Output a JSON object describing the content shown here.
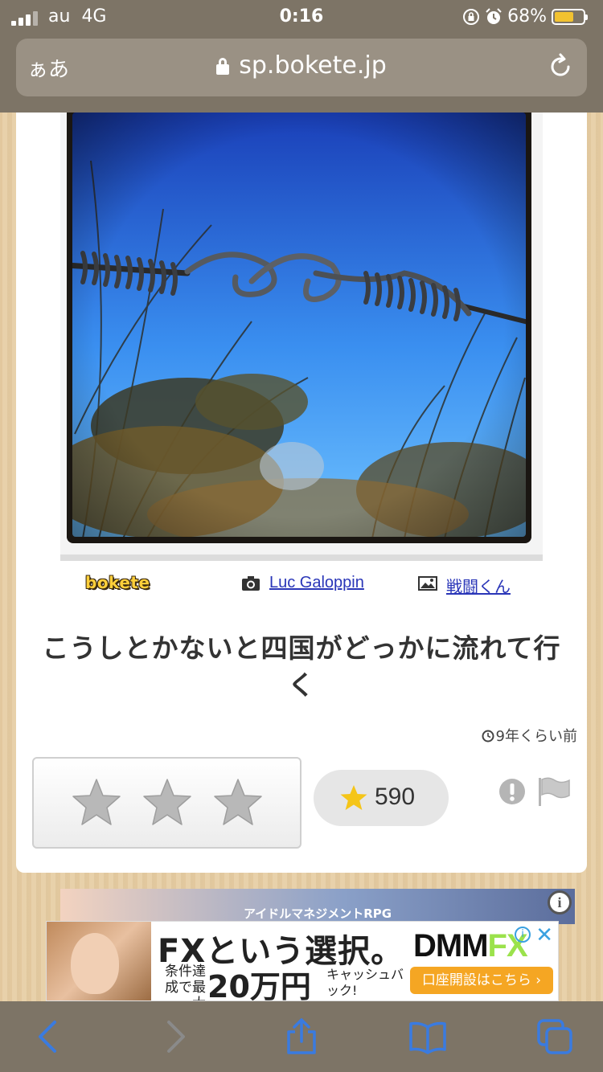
{
  "status": {
    "carrier": "au",
    "network": "4G",
    "time": "0:16",
    "battery": "68%",
    "battery_level": 0.68
  },
  "browser": {
    "text_size_label": "ぁあ",
    "url": "sp.bokete.jp"
  },
  "post": {
    "logo": "bokete",
    "photographer": "Luc Galoppin",
    "author": "戦闘くん",
    "caption": "こうしとかないと四国がどっかに流れて行く",
    "time_ago": "9年くらい前",
    "rating_stars": 3,
    "score": "590"
  },
  "ad": {
    "game_title": "アイドルマネジメントRPG",
    "info": "i",
    "headline": "FXという選択。",
    "condition": "条件達成で最大",
    "amount": "20万円",
    "cashback": "キャッシュバック!",
    "brand_main": "DMM",
    "brand_fx": "FX",
    "cta": "口座開設はこちら ›",
    "close": "✕"
  },
  "colors": {
    "chrome": "#7d7466",
    "link": "#2a36b8",
    "star_gold": "#f5c518",
    "ios_blue": "#3a7be0"
  },
  "icons": [
    "signal-icon",
    "orientation-lock-icon",
    "alarm-icon",
    "battery-icon",
    "lock-icon",
    "reload-icon",
    "camera-icon",
    "image-icon",
    "star-icon",
    "report-icon",
    "flag-icon",
    "back-icon",
    "forward-icon",
    "share-icon",
    "bookmarks-icon",
    "tabs-icon"
  ]
}
